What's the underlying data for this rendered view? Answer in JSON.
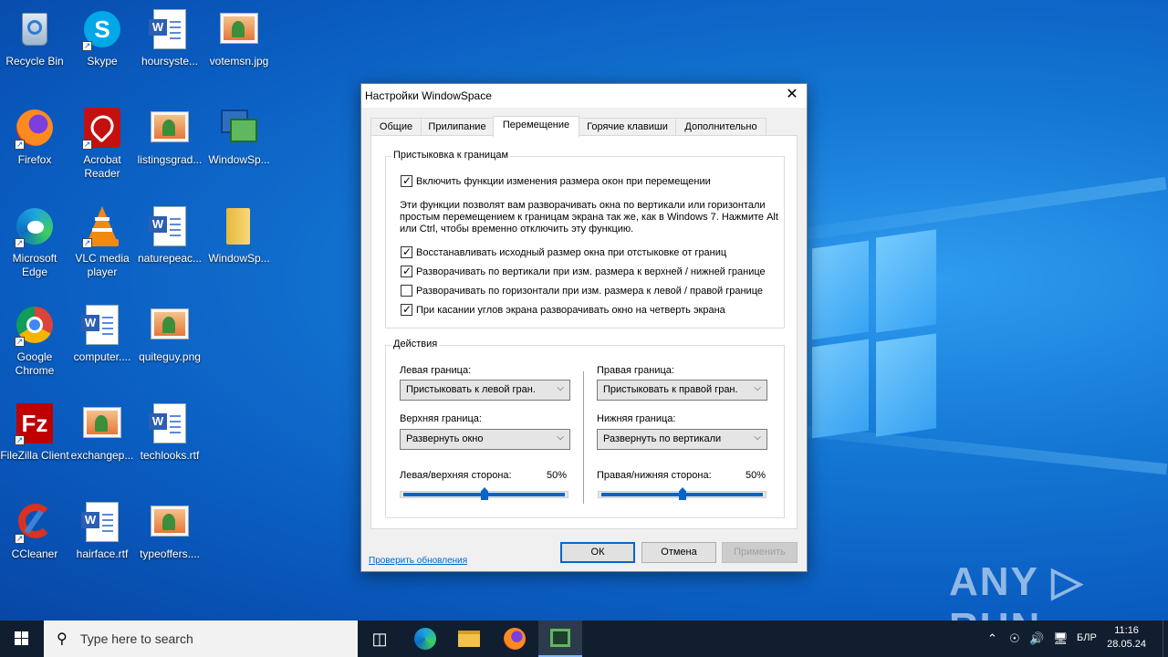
{
  "desktop": {
    "icons": [
      {
        "label": "Recycle Bin"
      },
      {
        "label": "Skype"
      },
      {
        "label": "hoursyste..."
      },
      {
        "label": "votemsn.jpg"
      },
      {
        "label": "Firefox"
      },
      {
        "label": "Acrobat Reader"
      },
      {
        "label": "listingsgrad..."
      },
      {
        "label": "WindowSp..."
      },
      {
        "label": "Microsoft Edge"
      },
      {
        "label": "VLC media player"
      },
      {
        "label": "naturepeac..."
      },
      {
        "label": "WindowSp..."
      },
      {
        "label": "Google Chrome"
      },
      {
        "label": "computer...."
      },
      {
        "label": "quiteguy.png"
      },
      {
        "label": "FileZilla Client"
      },
      {
        "label": "exchangep..."
      },
      {
        "label": "techlooks.rtf"
      },
      {
        "label": "CCleaner"
      },
      {
        "label": "hairface.rtf"
      },
      {
        "label": "typeoffers...."
      }
    ]
  },
  "dialog": {
    "title": "Настройки WindowSpace",
    "close": "✕",
    "tabs": [
      {
        "label": "Общие"
      },
      {
        "label": "Прилипание"
      },
      {
        "label": "Перемещение"
      },
      {
        "label": "Горячие клавиши"
      },
      {
        "label": "Дополнительно"
      }
    ],
    "group1": {
      "title": "Пристыковка к границам",
      "enable": {
        "label": "Включить функции изменения размера окон при перемещении",
        "checked": true
      },
      "description": "Эти функции позволят вам разворачивать окна по вертикали или горизонтали простым перемещением к границам экрана так же, как в Windows 7. Нажмите Alt или Ctrl, чтобы временно отключить эту функцию.",
      "options": [
        {
          "label": "Восстанавливать исходный размер окна при отстыковке от границ",
          "checked": true
        },
        {
          "label": "Разворачивать по вертикали при изм. размера к верхней / нижней границе",
          "checked": true
        },
        {
          "label": "Разворачивать по горизонтали при изм. размера к левой / правой границе",
          "checked": false
        },
        {
          "label": "При касании углов экрана разворачивать окно на четверть экрана",
          "checked": true
        }
      ]
    },
    "group2": {
      "title": "Действия",
      "left_border": {
        "label": "Левая граница:",
        "value": "Пристыковать к левой гран."
      },
      "right_border": {
        "label": "Правая граница:",
        "value": "Пристыковать к правой гран."
      },
      "top_border": {
        "label": "Верхняя граница:",
        "value": "Развернуть окно"
      },
      "bottom_border": {
        "label": "Нижняя граница:",
        "value": "Развернуть по вертикали"
      },
      "left_top_side": {
        "label": "Левая/верхняя сторона:",
        "percent": "50%",
        "value": 0.5
      },
      "right_bottom_side": {
        "label": "Правая/нижняя сторона:",
        "percent": "50%",
        "value": 0.5
      }
    },
    "check_updates": "Проверить обновления",
    "ok": "ОК",
    "cancel": "Отмена",
    "apply": "Применить"
  },
  "watermark": "ANY ▷ RUN",
  "taskbar": {
    "search_placeholder": "Type here to search",
    "language": "БЛР",
    "time": "11:16",
    "date": "28.05.24"
  },
  "colors": {
    "accent": "#0a64c8",
    "taskbar": "#101e2f",
    "desktop": "#1478d4"
  }
}
